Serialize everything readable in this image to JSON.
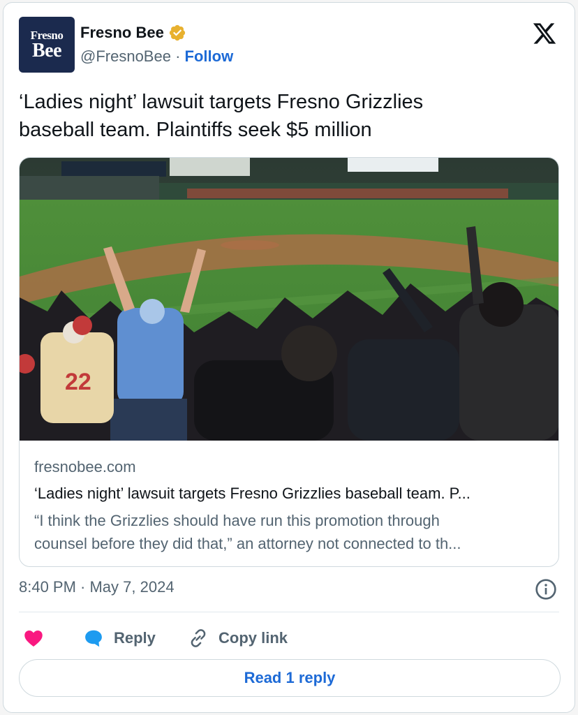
{
  "account": {
    "avatar_text_line1": "Fresno",
    "avatar_text_line2": "Bee",
    "name": "Fresno Bee",
    "handle": "@FresnoBee",
    "separator": "·",
    "follow_label": "Follow",
    "verified_badge_color": "#e8b12f"
  },
  "tweet": {
    "text_line1": "‘Ladies night’ lawsuit targets Fresno Grizzlies",
    "text_line2": "baseball team. Plaintiffs seek $5 million"
  },
  "link_card": {
    "image_icon": "baseball-stadium-photo",
    "domain": "fresnobee.com",
    "title": "‘Ladies night’ lawsuit targets Fresno Grizzlies baseball team. P...",
    "description_line1": "“I think the Grizzlies should have run this promotion through",
    "description_line2": "counsel before they did that,” an attorney not connected to th..."
  },
  "meta": {
    "timestamp": "8:40 PM · May 7, 2024",
    "info_icon": "info-icon"
  },
  "actions": {
    "like_icon": "heart-icon",
    "reply_icon": "speech-bubble-icon",
    "reply_label": "Reply",
    "copy_icon": "link-icon",
    "copy_label": "Copy link"
  },
  "read_reply_label": "Read 1 reply",
  "colors": {
    "accent": "#1d6ad6",
    "like": "#f91880",
    "reply": "#1d9bf0",
    "muted": "#536471"
  }
}
